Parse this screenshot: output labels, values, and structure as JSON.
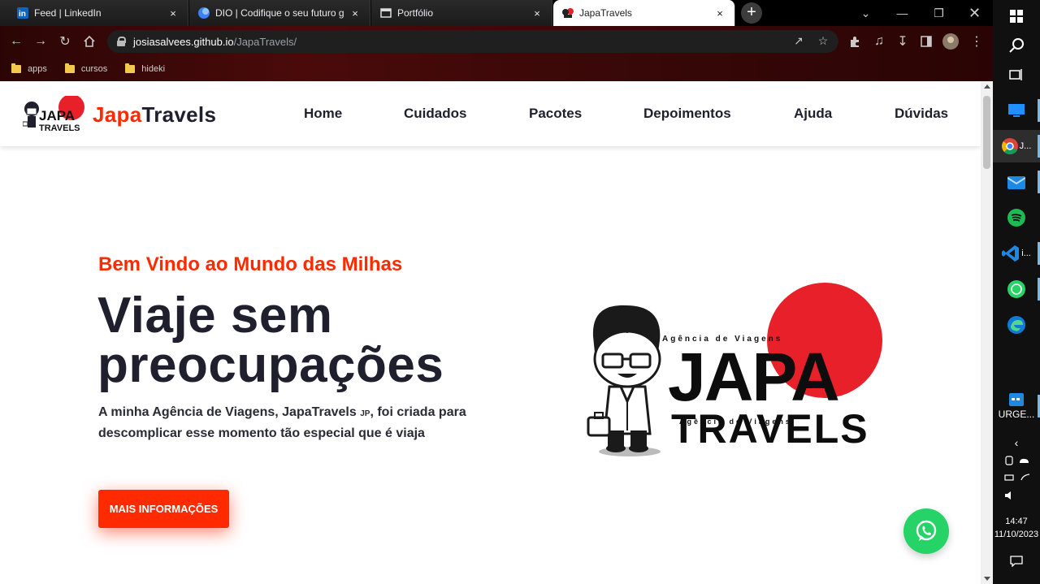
{
  "browser": {
    "tabs": [
      {
        "title": "Feed | LinkedIn",
        "icon": "linkedin-icon",
        "active": false
      },
      {
        "title": "DIO | Codifique o seu futuro glo",
        "icon": "dio-icon",
        "active": false
      },
      {
        "title": "Portfólio",
        "icon": "portfolio-icon",
        "active": false
      },
      {
        "title": "JapaTravels",
        "icon": "japatravels-icon",
        "active": true
      }
    ],
    "close_glyph": "×",
    "new_tab_glyph": "+",
    "url_host": "josiasalvees.github.io",
    "url_path": "/JapaTravels/",
    "bookmarks": [
      "apps",
      "cursos",
      "hideki"
    ]
  },
  "site": {
    "brand_accent": "Japa",
    "brand_rest": "Travels",
    "nav": [
      "Home",
      "Cuidados",
      "Pacotes",
      "Depoimentos",
      "Ajuda",
      "Dúvidas"
    ],
    "hero": {
      "kicker": "Bem Vindo ao Mundo das Milhas",
      "title_line1": "Viaje sem",
      "title_line2": "preocupações",
      "desc_part1": "A minha Agência de Viagens, JapaTravels ",
      "desc_jp": "JP",
      "desc_part2": ", foi criada para",
      "desc_line2": "descomplicar esse momento tão especial que é viaja",
      "cta": "MAIS INFORMAÇÕES"
    },
    "logo": {
      "tagline": "Agência de Viagens",
      "word1": "JAPA",
      "word2": "TRAVELS"
    },
    "colors": {
      "accent": "#ff2a00",
      "dark": "#1f1f2e",
      "sun": "#e8202a",
      "whatsapp": "#25d366"
    }
  },
  "taskbar": {
    "apps": [
      {
        "icon": "chrome-icon",
        "label": "J..."
      },
      {
        "icon": "mail-icon",
        "label": ""
      },
      {
        "icon": "spotify-icon",
        "label": ""
      },
      {
        "icon": "vscode-icon",
        "label": "i..."
      },
      {
        "icon": "whatsapp-icon",
        "label": ""
      },
      {
        "icon": "edge-icon",
        "label": ""
      }
    ],
    "urgent_label": "URGE...",
    "time": "14:47",
    "date": "11/10/2023"
  }
}
